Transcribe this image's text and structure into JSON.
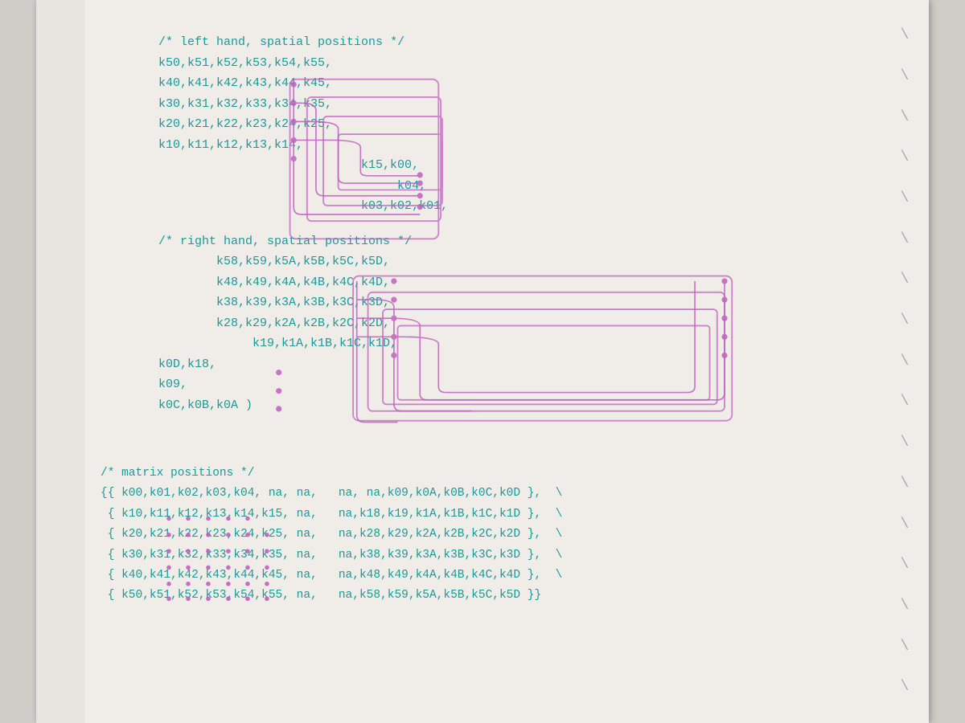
{
  "page": {
    "background": "#f0ede8",
    "left_hand_comment": "/* left hand, spatial positions */",
    "left_hand_rows": [
      "k50,k51,k52,k53,k54,k55,",
      "k40,k41,k42,k43,k44,k45,",
      "k30,k31,k32,k33,k34,k35,",
      "k20,k21,k22,k23,k24,k25,",
      "k10,k11,k12,k13,k14,"
    ],
    "left_hand_continuation": [
      "                    k15,k00,",
      "                         k04,",
      "                    k03,k02,k01,"
    ],
    "right_hand_comment": "/* right hand, spatial positions */",
    "right_hand_rows": [
      "        k58,k59,k5A,k5B,k5C,k5D,",
      "        k48,k49,k4A,k4B,k4C,k4D,",
      "        k38,k39,k3A,k3B,k3C,k3D,",
      "        k28,k29,k2A,k2B,k2C,k2D,",
      "             k19,k1A,k1B,k1C,k1D,"
    ],
    "right_hand_continuation": [
      "k0D,k18,",
      "k09,",
      "k0C,k0B,k0A )"
    ],
    "matrix_comment": "/* matrix positions */",
    "matrix_rows": [
      "{{ k00,k01,k02,k03,k04, na, na,   na, na,k09,k0A,k0B,k0C,k0D },",
      " { k10,k11,k12,k13,k14,k15, na,   na,k18,k19,k1A,k1B,k1C,k1D },",
      " { k20,k21,k22,k23,k24,k25, na,   na,k28,k29,k2A,k2B,k2C,k2D },",
      " { k30,k31,k32,k33,k34,k35, na,   na,k38,k39,k3A,k3B,k3C,k3D },",
      " { k40,k41,k42,k43,k44,k45, na,   na,k48,k49,k4A,k4B,k4C,k4D },",
      " { k50,k51,k52,k53,k54,k55, na,   na,k58,k59,k5A,k5B,k5C,k5D }}"
    ]
  }
}
